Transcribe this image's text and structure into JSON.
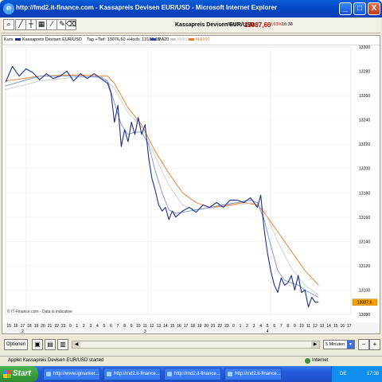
{
  "window": {
    "title": "http://fmd2.it-finance.com - Kassapreis Devisen EUR/USD - Microsoft Internet Explorer",
    "minimize": "_",
    "maximize": "□",
    "close": "X"
  },
  "toolbar": {
    "tools": [
      "zoom-icon",
      "line-icon",
      "crosshair-icon",
      "chart-icon",
      "fib-icon",
      "pen-icon",
      "trash-icon"
    ],
    "instrument_title": "Kassapreis Devisen EUR/USD",
    "source": "(Evtl.)",
    "price": "13087,60",
    "change": "-0,63%",
    "time": "16:38"
  },
  "legend": {
    "item1": "Kurs",
    "item2": "Kassapreis Devisen EUR/USD",
    "item3": "Tag +Tief: 13076,60 +Hoch: 13180,10",
    "ma20": "MA20",
    "ma50": "MA50",
    "ma100": "MA100"
  },
  "colors": {
    "price": "#1a2f8a",
    "ma20": "#7a90c8",
    "ma50": "#c8c8c8",
    "ma100": "#f07820",
    "price_badge": "#f5a000"
  },
  "chart_data": {
    "type": "line",
    "ylim": [
      13080,
      13300
    ],
    "yticks": [
      13080,
      13100,
      13120,
      13140,
      13160,
      13180,
      13200,
      13220,
      13240,
      13260,
      13280,
      13300
    ],
    "ytick_labels": [
      "13080",
      "13100",
      "13120",
      "13140",
      "13160",
      "13180",
      "13200",
      "13220",
      "13240",
      "13260",
      "13280",
      "13300"
    ],
    "hour_labels": [
      "15",
      "16",
      "17",
      "18",
      "19",
      "20",
      "21",
      "22",
      "23",
      "0",
      "1",
      "2",
      "3",
      "4",
      "5",
      "6",
      "7",
      "8",
      "9",
      "10",
      "11",
      "12",
      "13",
      "14",
      "15",
      "16",
      "17",
      "18",
      "19",
      "20",
      "21",
      "22",
      "23",
      "0",
      "1",
      "2",
      "3",
      "4",
      "5",
      "6",
      "7",
      "8",
      "9",
      "10",
      "11",
      "12",
      "13",
      "14",
      "15",
      "16",
      "17"
    ],
    "day_labels": [
      {
        "label": "2",
        "hour_index": 2
      },
      {
        "label": "3",
        "hour_index": 20
      },
      {
        "label": "4",
        "hour_index": 38
      }
    ],
    "last_price_label": "13087,6",
    "footer_note": "© IT-Finance.com - Data is indicative",
    "series": [
      {
        "name": "Kurs",
        "points": [
          [
            0,
            13271
          ],
          [
            1,
            13284
          ],
          [
            2,
            13276
          ],
          [
            3,
            13282
          ],
          [
            4,
            13279
          ],
          [
            5,
            13273
          ],
          [
            6,
            13278
          ],
          [
            7,
            13274
          ],
          [
            8,
            13276
          ],
          [
            9,
            13280
          ],
          [
            10,
            13272
          ],
          [
            11,
            13278
          ],
          [
            12,
            13274
          ],
          [
            13,
            13278
          ],
          [
            14,
            13274
          ],
          [
            15,
            13270
          ],
          [
            15.5,
            13262
          ],
          [
            16,
            13238
          ],
          [
            16.5,
            13252
          ],
          [
            17,
            13218
          ],
          [
            17.5,
            13232
          ],
          [
            18,
            13222
          ],
          [
            18.5,
            13238
          ],
          [
            19,
            13228
          ],
          [
            19.5,
            13242
          ],
          [
            20,
            13228
          ],
          [
            20.5,
            13236
          ],
          [
            21,
            13210
          ],
          [
            21.5,
            13192
          ],
          [
            22,
            13182
          ],
          [
            22.5,
            13170
          ],
          [
            23,
            13165
          ],
          [
            23.5,
            13168
          ],
          [
            24,
            13158
          ],
          [
            24.5,
            13165
          ],
          [
            25,
            13160
          ],
          [
            26,
            13165
          ],
          [
            27,
            13168
          ],
          [
            28,
            13164
          ],
          [
            29,
            13170
          ],
          [
            30,
            13168
          ],
          [
            31,
            13172
          ],
          [
            32,
            13168
          ],
          [
            33,
            13174
          ],
          [
            34,
            13174
          ],
          [
            35,
            13172
          ],
          [
            36,
            13176
          ],
          [
            37,
            13168
          ],
          [
            37.5,
            13178
          ],
          [
            38,
            13150
          ],
          [
            38.5,
            13130
          ],
          [
            39,
            13115
          ],
          [
            39.5,
            13104
          ],
          [
            40,
            13098
          ],
          [
            40.5,
            13110
          ],
          [
            41,
            13104
          ],
          [
            41.5,
            13106
          ],
          [
            42,
            13112
          ],
          [
            42.5,
            13100
          ],
          [
            43,
            13112
          ],
          [
            43.5,
            13098
          ],
          [
            44,
            13100
          ],
          [
            44.5,
            13086
          ],
          [
            45,
            13094
          ],
          [
            45.5,
            13090
          ],
          [
            46,
            13090
          ]
        ]
      },
      {
        "name": "MA20",
        "points": [
          [
            0,
            13268
          ],
          [
            5,
            13276
          ],
          [
            10,
            13276
          ],
          [
            14,
            13275
          ],
          [
            15,
            13272
          ],
          [
            16,
            13254
          ],
          [
            17,
            13236
          ],
          [
            18,
            13228
          ],
          [
            19,
            13230
          ],
          [
            20,
            13230
          ],
          [
            21,
            13220
          ],
          [
            22,
            13198
          ],
          [
            23,
            13180
          ],
          [
            24,
            13166
          ],
          [
            25,
            13163
          ],
          [
            27,
            13165
          ],
          [
            30,
            13168
          ],
          [
            33,
            13171
          ],
          [
            36,
            13174
          ],
          [
            37,
            13172
          ],
          [
            38,
            13158
          ],
          [
            39,
            13136
          ],
          [
            40,
            13116
          ],
          [
            41,
            13108
          ],
          [
            42,
            13106
          ],
          [
            43,
            13104
          ],
          [
            44,
            13100
          ],
          [
            46,
            13094
          ]
        ]
      },
      {
        "name": "MA50",
        "points": [
          [
            0,
            13265
          ],
          [
            5,
            13272
          ],
          [
            10,
            13275
          ],
          [
            14,
            13276
          ],
          [
            16,
            13266
          ],
          [
            18,
            13246
          ],
          [
            20,
            13234
          ],
          [
            22,
            13210
          ],
          [
            24,
            13186
          ],
          [
            26,
            13170
          ],
          [
            28,
            13166
          ],
          [
            31,
            13168
          ],
          [
            34,
            13170
          ],
          [
            37,
            13172
          ],
          [
            38,
            13166
          ],
          [
            40,
            13140
          ],
          [
            42,
            13118
          ],
          [
            44,
            13104
          ],
          [
            46,
            13096
          ]
        ]
      },
      {
        "name": "MA100",
        "points": [
          [
            0,
            13272
          ],
          [
            5,
            13276
          ],
          [
            10,
            13277
          ],
          [
            15,
            13276
          ],
          [
            16,
            13270
          ],
          [
            18,
            13250
          ],
          [
            20,
            13236
          ],
          [
            22,
            13214
          ],
          [
            24,
            13196
          ],
          [
            26,
            13180
          ],
          [
            28,
            13172
          ],
          [
            30,
            13168
          ],
          [
            32,
            13169
          ],
          [
            35,
            13172
          ],
          [
            37,
            13170
          ],
          [
            38,
            13164
          ],
          [
            40,
            13148
          ],
          [
            42,
            13132
          ],
          [
            44,
            13116
          ],
          [
            46,
            13104
          ]
        ]
      }
    ]
  },
  "bottombar": {
    "options_label": "Optionen",
    "interval_label": "5 Minuten",
    "zoom_in": "+",
    "zoom_out": "−"
  },
  "status": {
    "text": "Applet Kassapreis Devisen EUR/USD started",
    "zone": "Internet"
  },
  "taskbar": {
    "start_label": "Start",
    "tasks": [
      "http://www.igmarket...",
      "http://md2.it-finance...",
      "http://md2.it-finance...",
      "http://md2.it-finance..."
    ],
    "lang": "DE",
    "clock": "17:38"
  }
}
